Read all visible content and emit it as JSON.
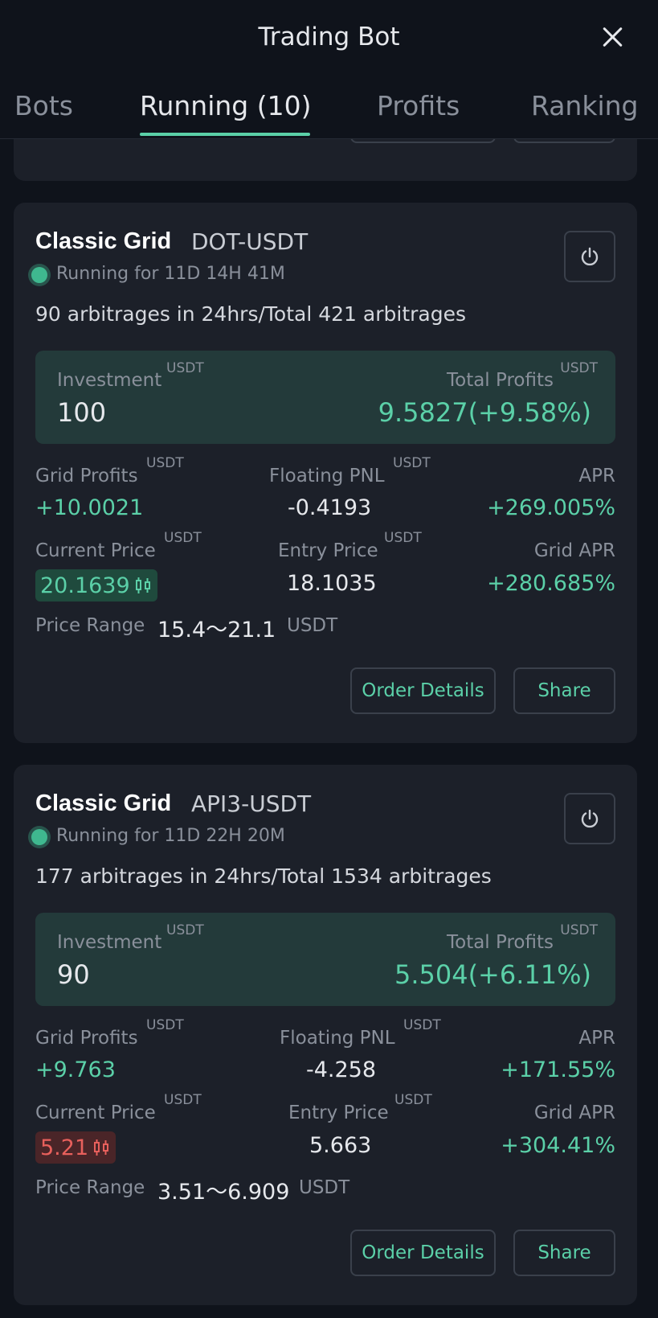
{
  "header": {
    "title": "Trading Bot",
    "tabs": [
      {
        "label": "Bots"
      },
      {
        "label": "Running (10)"
      },
      {
        "label": "Profits"
      },
      {
        "label": "Ranking"
      }
    ]
  },
  "bots": [
    {
      "type": "Classic Grid",
      "pair": "DOT-USDT",
      "running": "Running for 11D 14H 41M",
      "arbitrages": "90 arbitrages in 24hrs/Total 421 arbitrages",
      "investment_label": "Investment",
      "investment": "100",
      "total_profits_label": "Total Profits",
      "total_profits": "9.5827(+9.58%)",
      "grid_profits_label": "Grid Profits",
      "grid_profits": "+10.0021",
      "floating_pnl_label": "Floating PNL",
      "floating_pnl": "-0.4193",
      "apr_label": "APR",
      "apr": "+269.005%",
      "current_price_label": "Current Price",
      "current_price": "20.1639",
      "entry_price_label": "Entry Price",
      "entry_price": "18.1035",
      "grid_apr_label": "Grid APR",
      "grid_apr": "+280.685%",
      "price_range_label": "Price Range",
      "price_range": "15.4～21.1",
      "unit": "USDT",
      "order_details_label": "Order Details",
      "share_label": "Share"
    },
    {
      "type": "Classic Grid",
      "pair": "API3-USDT",
      "running": "Running for 11D 22H 20M",
      "arbitrages": "177 arbitrages in 24hrs/Total 1534 arbitrages",
      "investment_label": "Investment",
      "investment": "90",
      "total_profits_label": "Total Profits",
      "total_profits": "5.504(+6.11%)",
      "grid_profits_label": "Grid Profits",
      "grid_profits": "+9.763",
      "floating_pnl_label": "Floating PNL",
      "floating_pnl": "-4.258",
      "apr_label": "APR",
      "apr": "+171.55%",
      "current_price_label": "Current Price",
      "current_price": "5.21",
      "entry_price_label": "Entry Price",
      "entry_price": "5.663",
      "grid_apr_label": "Grid APR",
      "grid_apr": "+304.41%",
      "price_range_label": "Price Range",
      "price_range": "3.51～6.909",
      "unit": "USDT",
      "order_details_label": "Order Details",
      "share_label": "Share"
    }
  ],
  "colors": {
    "background": "#0f131b",
    "card": "#1c2029",
    "accent_green": "#5bd0a8",
    "accent_red": "#e8605c",
    "investment_box": "#233a3a"
  },
  "icons": [
    "close-icon",
    "power-icon",
    "candlestick-icon",
    "status-dot-icon"
  ]
}
